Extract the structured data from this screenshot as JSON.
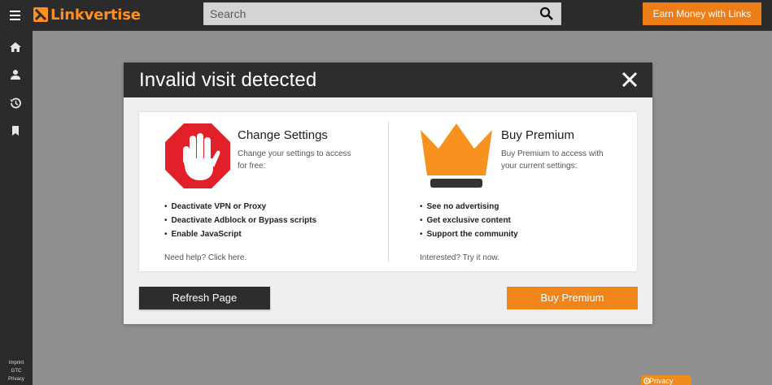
{
  "colors": {
    "brand": "#ff8f1f",
    "accent": "#ed7d17",
    "dark": "#2b2b2b",
    "stop_red": "#e2202a"
  },
  "header": {
    "menu_icon": "hamburger-icon",
    "logo_text": "Linkvertise",
    "search": {
      "placeholder": "Search",
      "icon": "search-icon"
    },
    "earn_label": "Earn Money with Links"
  },
  "sidebar": {
    "items": [
      {
        "icon": "home-icon"
      },
      {
        "icon": "user-icon"
      },
      {
        "icon": "history-icon"
      },
      {
        "icon": "bookmark-icon"
      }
    ],
    "footer_links": [
      "Imprint",
      "GTC",
      "Privacy"
    ]
  },
  "privacy_tab": {
    "label": "Privacy",
    "icon": "gear-icon"
  },
  "modal": {
    "title": "Invalid visit detected",
    "close_icon": "close-icon",
    "left": {
      "icon": "stop-hand-icon",
      "title": "Change Settings",
      "description": "Change your settings to access for free:",
      "bullets": [
        "Deactivate VPN or Proxy",
        "Deactivate Adblock or Bypass scripts",
        "Enable JavaScript"
      ],
      "footer": "Need help? Click here."
    },
    "right": {
      "icon": "crown-icon",
      "title": "Buy Premium",
      "description": "Buy Premium to access with your current settings:",
      "bullets": [
        "See no advertising",
        "Get exclusive content",
        "Support the community"
      ],
      "footer": "Interested? Try it now."
    },
    "refresh_label": "Refresh Page",
    "premium_label": "Buy Premium"
  }
}
